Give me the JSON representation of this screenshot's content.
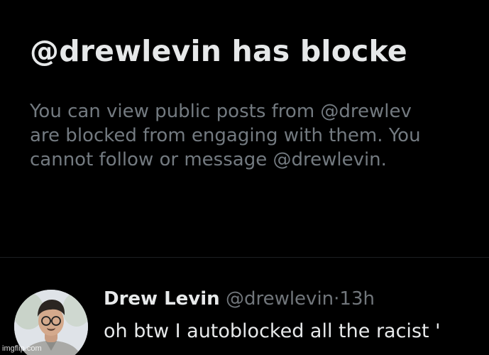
{
  "blocked_notice": {
    "title": "@drewlevin has blocke",
    "description_lines": [
      "You can view public posts from @drewlev",
      "are blocked from engaging with them. You",
      "cannot follow or message @drewlevin."
    ]
  },
  "tweet": {
    "author_name": "Drew Levin",
    "author_handle": "@drewlevin",
    "separator": "·",
    "timestamp": "13h",
    "text": "oh btw I autoblocked all the racist '"
  },
  "watermark": "imgflip.com",
  "colors": {
    "background": "#000000",
    "primary_text": "#e7e9ea",
    "secondary_text": "#71767b"
  },
  "icons": {
    "avatar": "profile-photo"
  }
}
